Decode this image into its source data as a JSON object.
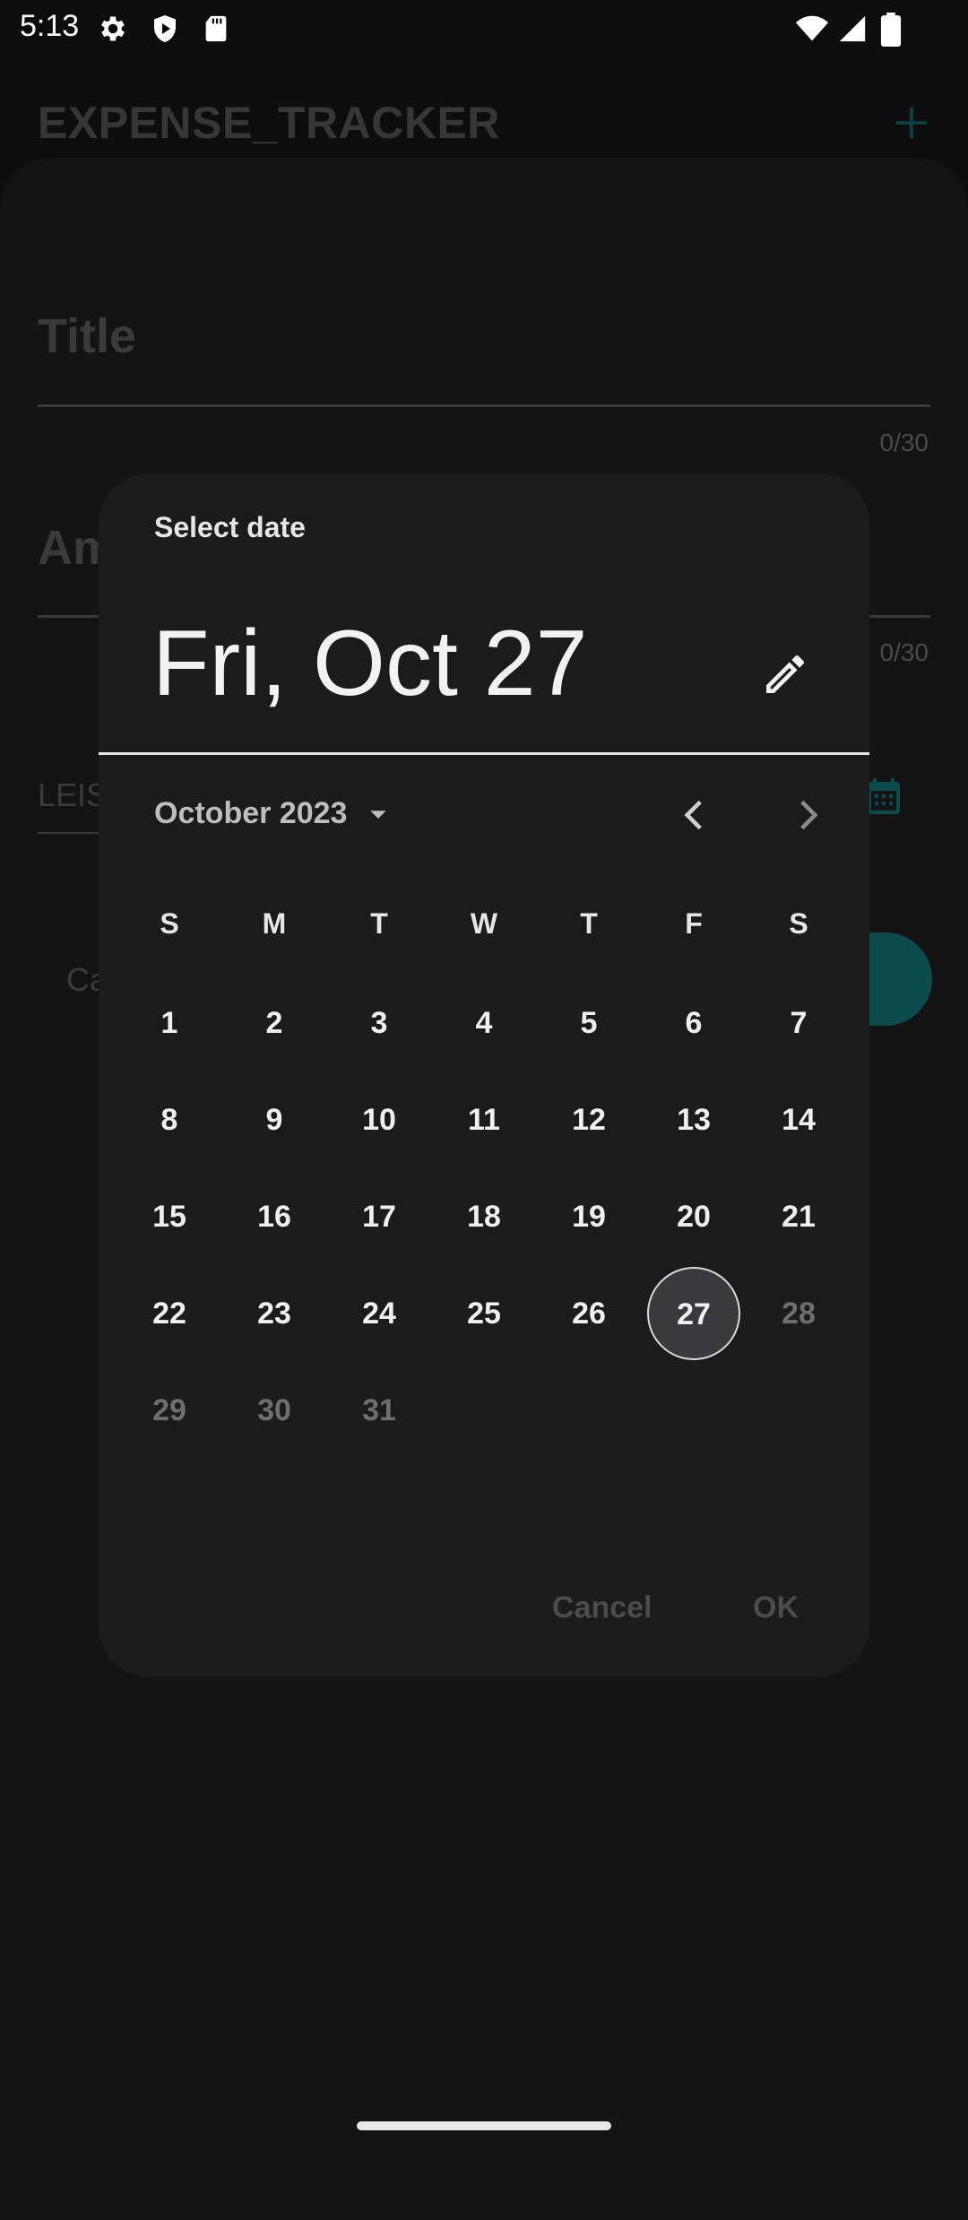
{
  "status_bar": {
    "time": "5:13"
  },
  "app": {
    "title": "EXPENSE_TRACKER",
    "form": {
      "title_label": "Title",
      "title_counter": "0/30",
      "amount_label": "Am",
      "amount_counter": "0/30",
      "category_value": "LEIS",
      "cancel_label": "Ca"
    }
  },
  "dialog": {
    "label": "Select date",
    "headline": "Fri, Oct 27",
    "month_year": "October 2023",
    "weekdays": [
      "S",
      "M",
      "T",
      "W",
      "T",
      "F",
      "S"
    ],
    "weeks": [
      [
        "1",
        "2",
        "3",
        "4",
        "5",
        "6",
        "7"
      ],
      [
        "8",
        "9",
        "10",
        "11",
        "12",
        "13",
        "14"
      ],
      [
        "15",
        "16",
        "17",
        "18",
        "19",
        "20",
        "21"
      ],
      [
        "22",
        "23",
        "24",
        "25",
        "26",
        "27",
        "28"
      ],
      [
        "29",
        "30",
        "31"
      ]
    ],
    "selected_day": "27",
    "disabled_days": [
      "28",
      "29",
      "30",
      "31"
    ],
    "cancel_label": "Cancel",
    "ok_label": "OK"
  },
  "colors": {
    "background": "#0d0d0d",
    "dialog": "#1b1b1b",
    "accent": "#0b4a4d"
  }
}
